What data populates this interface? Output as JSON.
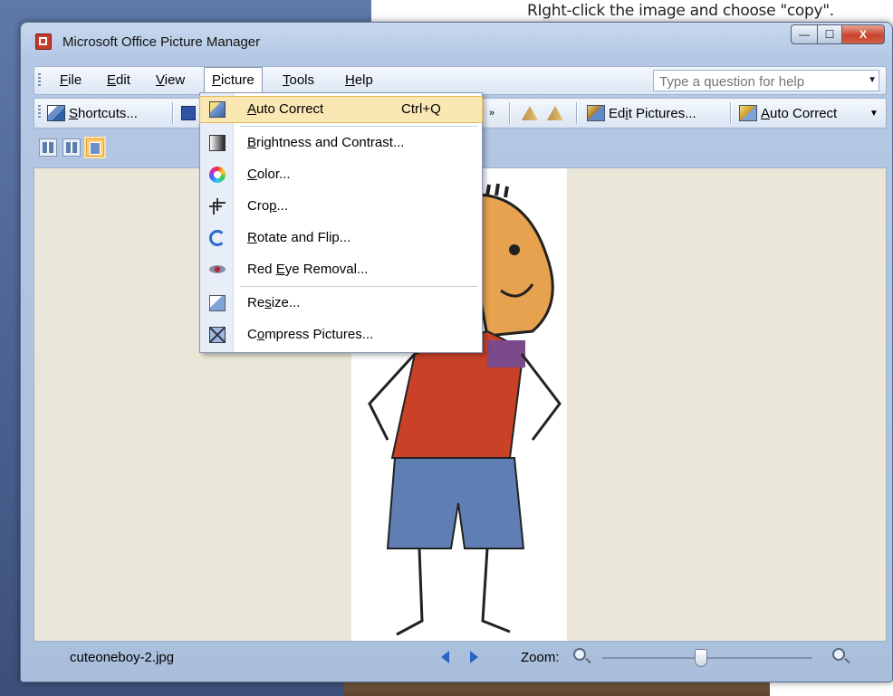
{
  "instruction": "RIght-click the image and choose  \"copy\".",
  "window": {
    "title": "Microsoft Office Picture Manager",
    "controls": {
      "minimize": "—",
      "maximize": "☐",
      "close": "X"
    }
  },
  "menubar": {
    "items": [
      {
        "label": "File",
        "key": "F",
        "rest": "ile"
      },
      {
        "label": "Edit",
        "key": "E",
        "rest": "dit"
      },
      {
        "label": "View",
        "key": "V",
        "rest": "iew"
      },
      {
        "label": "Picture",
        "key": "P",
        "rest": "icture"
      },
      {
        "label": "Tools",
        "key": "T",
        "rest": "ools"
      },
      {
        "label": "Help",
        "key": "H",
        "rest": "elp"
      }
    ],
    "help_placeholder": "Type a question for help"
  },
  "toolbar": {
    "shortcuts": {
      "pre": "",
      "key": "S",
      "rest": "hortcuts..."
    },
    "edit_pictures": {
      "pre": "Ed",
      "key": "i",
      "rest": "t Pictures..."
    },
    "auto_correct": {
      "pre": "",
      "key": "A",
      "rest": "uto Correct"
    }
  },
  "picture_menu": {
    "items": [
      {
        "label": "Auto Correct",
        "pre": "",
        "key": "A",
        "rest": "uto Correct",
        "shortcut": "Ctrl+Q",
        "icon": "auto-correct-icon"
      },
      {
        "label": "Brightness and Contrast...",
        "pre": "",
        "key": "B",
        "rest": "rightness and Contrast...",
        "icon": "brightness-icon"
      },
      {
        "label": "Color...",
        "pre": "",
        "key": "C",
        "rest": "olor...",
        "icon": "color-wheel-icon"
      },
      {
        "label": "Crop...",
        "pre": "Cro",
        "key": "p",
        "rest": "...",
        "icon": "crop-icon"
      },
      {
        "label": "Rotate and Flip...",
        "pre": "",
        "key": "R",
        "rest": "otate and Flip...",
        "icon": "rotate-icon"
      },
      {
        "label": "Red Eye Removal...",
        "pre": "Red ",
        "key": "E",
        "rest": "ye Removal...",
        "icon": "red-eye-icon"
      },
      {
        "label": "Resize...",
        "pre": "Re",
        "key": "s",
        "rest": "ize...",
        "icon": "resize-icon"
      },
      {
        "label": "Compress Pictures...",
        "pre": "C",
        "key": "o",
        "rest": "mpress Pictures...",
        "icon": "compress-icon"
      }
    ]
  },
  "statusbar": {
    "filename": "cuteoneboy-2.jpg",
    "zoom_label": "Zoom:",
    "zoom_level": 0.47
  },
  "colors": {
    "menu_highlight": "#f9e7b4",
    "content_bg": "#ebe7d8",
    "nav_arrow": "#2a64c8"
  }
}
